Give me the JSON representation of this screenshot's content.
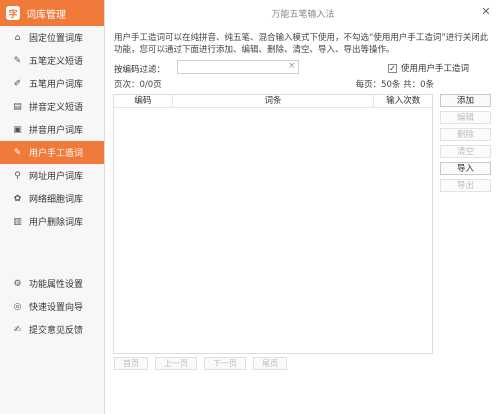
{
  "sidebar": {
    "title": "词库管理",
    "logo_glyph": "字",
    "items": [
      {
        "label": "固定位置词库",
        "icon": "pin-icon"
      },
      {
        "label": "五笔定义短语",
        "icon": "pen-icon"
      },
      {
        "label": "五笔用户词库",
        "icon": "edit-icon"
      },
      {
        "label": "拼音定义短语",
        "icon": "book-icon"
      },
      {
        "label": "拼音用户词库",
        "icon": "user-card-icon"
      },
      {
        "label": "用户手工造词",
        "icon": "brush-icon"
      },
      {
        "label": "网址用户词库",
        "icon": "link-icon"
      },
      {
        "label": "网络细胞词库",
        "icon": "cell-icon"
      },
      {
        "label": "用户删除词库",
        "icon": "trash-icon"
      }
    ],
    "items2": [
      {
        "label": "功能属性设置",
        "icon": "gear-icon"
      },
      {
        "label": "快速设置向导",
        "icon": "compass-icon"
      },
      {
        "label": "提交意见反馈",
        "icon": "feedback-icon"
      }
    ]
  },
  "window": {
    "title": "万能五笔输入法",
    "close": "✕"
  },
  "main": {
    "description": "用户手工造词可以在纯拼音、纯五笔、混合输入模式下使用，不勾选“使用用户手工造词”进行关闭此功能，您可以通过下面进行添加、编辑、删除、清空、导入、导出等操作。",
    "filter_label": "按编码过滤：",
    "filter_value": "",
    "filter_clear": "×",
    "use_checkbox_label": "使用用户手工造词",
    "use_checked": true,
    "page_info": "页次：0/0页",
    "per_page_info": "每页：50条 共：0条",
    "columns": [
      "编码",
      "词条",
      "输入次数"
    ],
    "buttons": [
      {
        "label": "添加",
        "enabled": true
      },
      {
        "label": "编辑",
        "enabled": false
      },
      {
        "label": "删除",
        "enabled": false
      },
      {
        "label": "清空",
        "enabled": false
      },
      {
        "label": "导入",
        "enabled": true
      },
      {
        "label": "导出",
        "enabled": false
      }
    ],
    "pager": [
      "首页",
      "上一页",
      "下一页",
      "尾页"
    ]
  }
}
